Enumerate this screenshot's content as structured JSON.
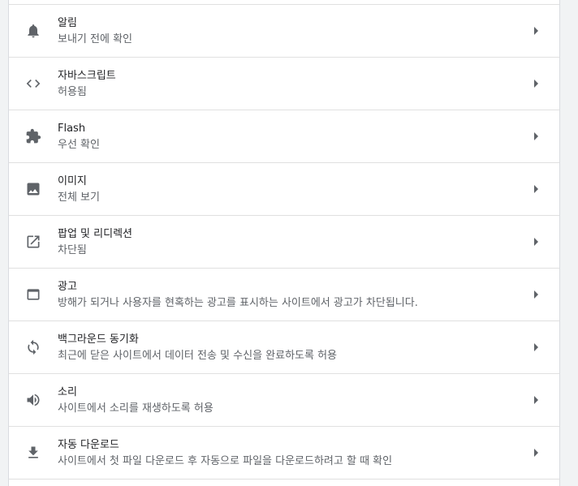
{
  "settings": {
    "items": [
      {
        "icon": "bell-icon",
        "title": "알림",
        "subtitle": "보내기 전에 확인"
      },
      {
        "icon": "code-icon",
        "title": "자바스크립트",
        "subtitle": "허용됨"
      },
      {
        "icon": "puzzle-icon",
        "title": "Flash",
        "subtitle": "우선 확인"
      },
      {
        "icon": "image-icon",
        "title": "이미지",
        "subtitle": "전체 보기"
      },
      {
        "icon": "open-in-new-icon",
        "title": "팝업 및 리디렉션",
        "subtitle": "차단됨"
      },
      {
        "icon": "window-icon",
        "title": "광고",
        "subtitle": "방해가 되거나 사용자를 현혹하는 광고를 표시하는 사이트에서 광고가 차단됩니다."
      },
      {
        "icon": "sync-icon",
        "title": "백그라운드 동기화",
        "subtitle": "최근에 닫은 사이트에서 데이터 전송 및 수신을 완료하도록 허용"
      },
      {
        "icon": "volume-icon",
        "title": "소리",
        "subtitle": "사이트에서 소리를 재생하도록 허용"
      },
      {
        "icon": "download-icon",
        "title": "자동 다운로드",
        "subtitle": "사이트에서 첫 파일 다운로드 후 자동으로 파일을 다운로드하려고 할 때 확인"
      }
    ]
  },
  "colors": {
    "icon": "#5f6368",
    "title": "#202124",
    "subtitle": "#5f6368",
    "divider": "#e0e0e0",
    "background": "#f1f3f4"
  }
}
